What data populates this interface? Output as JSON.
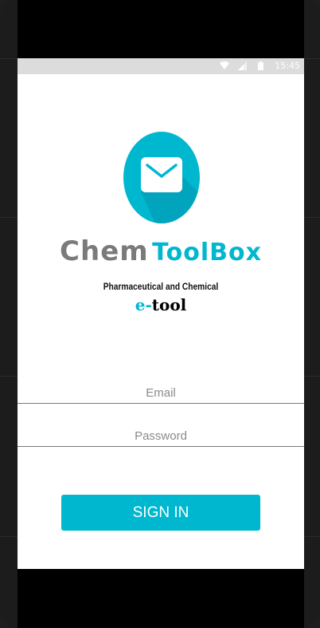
{
  "status_bar": {
    "time": "15:45",
    "icons": [
      "wifi-icon",
      "cell-signal-icon",
      "battery-icon"
    ]
  },
  "logo": {
    "icon": "envelope-icon",
    "color": "#00b7d0"
  },
  "brand": {
    "word1": "Chem",
    "word2": "ToolBox",
    "tagline": "Pharmaceutical and Chemical",
    "etool_prefix": "e-",
    "etool_suffix": "tool"
  },
  "form": {
    "email_placeholder": "Email",
    "password_placeholder": "Password",
    "signin_label": "SIGN IN"
  },
  "colors": {
    "accent": "#00b7d0",
    "status_bar": "#dcdcdc",
    "device": "#1c1c1c"
  }
}
